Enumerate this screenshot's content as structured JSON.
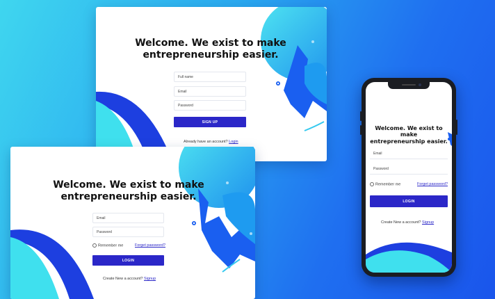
{
  "signup_card": {
    "headline_line1": "Welcome. We exist to make",
    "headline_line2": "entrepreneurship easier.",
    "fullname_placeholder": "Full name",
    "email_placeholder": "Email",
    "password_placeholder": "Password",
    "signup_button": "SIGN UP",
    "footer_text": "Already have an account?",
    "footer_link": "Login"
  },
  "login_card": {
    "headline_line1": "Welcome. We exist to make",
    "headline_line2": "entrepreneurship easier.",
    "email_placeholder": "Email",
    "password_placeholder": "Password",
    "remember_label": "Remember me",
    "forgot_link": "Forget password?",
    "login_button": "LOGIN",
    "footer_text": "Create New a account?",
    "footer_link": "Signup"
  },
  "phone_login": {
    "headline_line1": "Welcome. We exist to make",
    "headline_line2": "entrepreneurship easier.",
    "email_placeholder": "Email",
    "password_placeholder": "Password",
    "remember_label": "Remember me",
    "forgot_link": "Forget password?",
    "login_button": "LOGIN",
    "footer_text": "Create New a account?",
    "footer_link": "Signup"
  },
  "colors": {
    "accent_button": "#2b27c8",
    "cyan_shape": "#3fe0ee",
    "blue_shape": "#1f5ff0"
  }
}
